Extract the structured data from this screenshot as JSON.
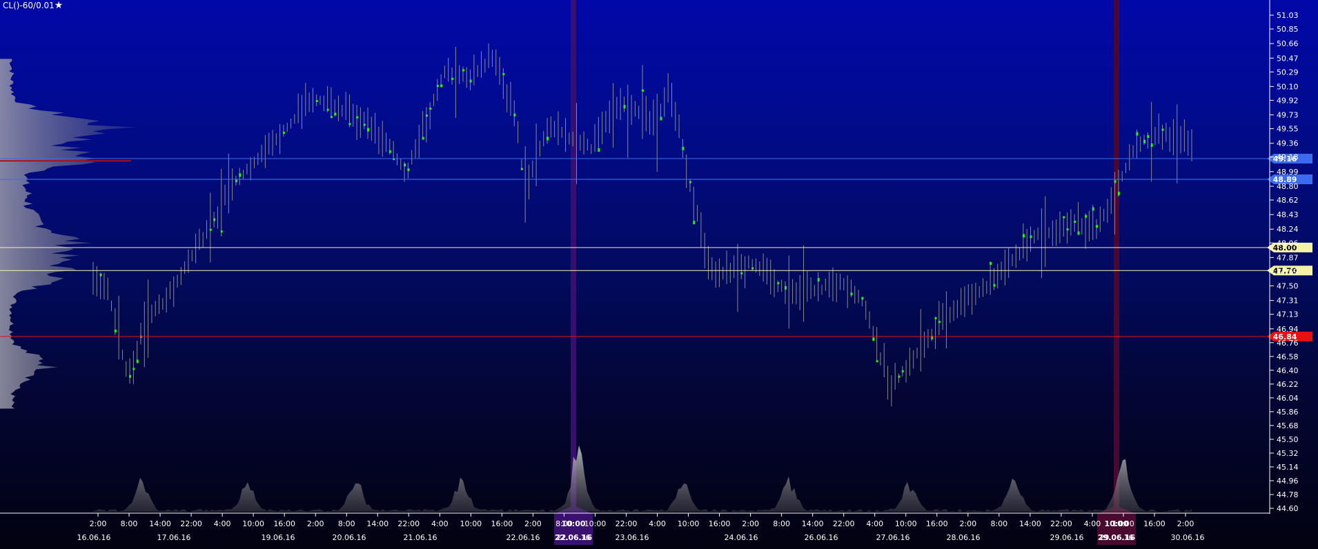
{
  "header": {
    "symbol": "CL()-60/0.01",
    "favorite_icon": "star-icon"
  },
  "colors": {
    "bar": "#8a8a8a",
    "highlight_bar": "#22ee22",
    "axis_text": "#ffffff",
    "blue_level": "#3b6cf0",
    "yellow_level": "#f5f2a6",
    "red_level": "#e81010",
    "session_marker_1": "#3a1070",
    "session_marker_2": "#4a0a30"
  },
  "chart_data": {
    "type": "ohlc",
    "ylim": [
      44.6,
      51.03
    ],
    "y_ticks": [
      "51.03",
      "50.85",
      "50.66",
      "50.47",
      "50.29",
      "50.10",
      "49.92",
      "49.73",
      "49.55",
      "49.36",
      "49.18",
      "48.99",
      "48.80",
      "48.62",
      "48.43",
      "48.24",
      "48.06",
      "47.87",
      "47.69",
      "47.50",
      "47.31",
      "47.13",
      "46.94",
      "46.76",
      "46.58",
      "46.40",
      "46.22",
      "46.04",
      "45.86",
      "45.68",
      "45.50",
      "45.32",
      "45.14",
      "44.96",
      "44.78",
      "44.60"
    ],
    "levels": [
      {
        "label": "49.16",
        "value": 49.16,
        "color": "blue"
      },
      {
        "label": "48.89",
        "value": 48.89,
        "color": "blue"
      },
      {
        "label": "48.00",
        "value": 48.0,
        "color": "yellow"
      },
      {
        "label": "47.70",
        "value": 47.7,
        "color": "yellow"
      },
      {
        "label": "46.84",
        "value": 46.84,
        "color": "red"
      }
    ],
    "time_ticks": [
      "2:00",
      "8:00",
      "14:00",
      "22:00",
      "4:00",
      "10:00",
      "16:00",
      "2:00",
      "8:00",
      "14:00",
      "22:00",
      "4:00",
      "10:00",
      "16:00",
      "2:00",
      "8:00",
      "10:00",
      "22:00",
      "4:00",
      "10:00",
      "16:00",
      "2:00",
      "8:00",
      "14:00",
      "22:00",
      "4:00",
      "10:00",
      "16:00",
      "2:00",
      "8:00",
      "14:00",
      "22:00",
      "4:00",
      "10:00",
      "16:00",
      "2:00"
    ],
    "date_ticks": [
      "16.06.16",
      "17.06.16",
      "19.06.16",
      "20.06.16",
      "21.06.16",
      "22.06.16",
      "22.06.16",
      "23.06.16",
      "24.06.16",
      "26.06.16",
      "27.06.16",
      "28.06.16",
      "29.06.16",
      "29.06.16",
      "30.06.16"
    ],
    "session_markers": [
      {
        "time": "10:00",
        "date": "22.06.16"
      },
      {
        "time": "10:00",
        "date": "29.06.16"
      }
    ],
    "path_points": [
      [
        0,
        47.6
      ],
      [
        8,
        47.4
      ],
      [
        12,
        46.9
      ],
      [
        18,
        46.3
      ],
      [
        26,
        47.0
      ],
      [
        34,
        47.25
      ],
      [
        42,
        47.5
      ],
      [
        52,
        48.0
      ],
      [
        60,
        48.3
      ],
      [
        70,
        48.8
      ],
      [
        84,
        49.2
      ],
      [
        98,
        49.55
      ],
      [
        110,
        49.95
      ],
      [
        124,
        49.85
      ],
      [
        138,
        49.6
      ],
      [
        150,
        49.35
      ],
      [
        158,
        48.95
      ],
      [
        168,
        49.6
      ],
      [
        178,
        50.3
      ],
      [
        190,
        50.2
      ],
      [
        202,
        50.5
      ],
      [
        208,
        50.1
      ],
      [
        214,
        49.7
      ],
      [
        218,
        48.8
      ],
      [
        224,
        49.1
      ],
      [
        230,
        49.6
      ],
      [
        240,
        49.45
      ],
      [
        252,
        49.3
      ],
      [
        262,
        49.8
      ],
      [
        274,
        49.85
      ],
      [
        284,
        49.6
      ],
      [
        292,
        50.1
      ],
      [
        304,
        48.6
      ],
      [
        314,
        47.6
      ],
      [
        324,
        47.7
      ],
      [
        334,
        47.8
      ],
      [
        344,
        47.55
      ],
      [
        354,
        47.4
      ],
      [
        366,
        47.45
      ],
      [
        380,
        47.55
      ],
      [
        390,
        47.3
      ],
      [
        398,
        46.6
      ],
      [
        404,
        46.2
      ],
      [
        414,
        46.5
      ],
      [
        426,
        46.95
      ],
      [
        440,
        47.3
      ],
      [
        452,
        47.5
      ],
      [
        464,
        47.8
      ],
      [
        476,
        48.15
      ],
      [
        488,
        48.25
      ],
      [
        496,
        48.35
      ],
      [
        508,
        48.25
      ],
      [
        514,
        48.5
      ],
      [
        528,
        49.35
      ],
      [
        540,
        49.5
      ],
      [
        556,
        49.4
      ]
    ]
  }
}
